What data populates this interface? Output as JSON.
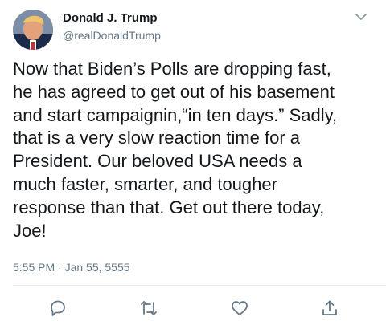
{
  "tweet": {
    "author": {
      "name": "Donald J. Trump",
      "handle": "@realDonaldTrump",
      "avatar_icon": "profile-photo"
    },
    "text_lines": [
      "Now that Biden’s Polls are dropping fast,",
      "he has agreed to get out of his basement",
      "and start campaignin,“in ten days.” Sadly,",
      "that is a very slow reaction time for a",
      "President. Our beloved USA needs a",
      "much faster, smarter, and tougher",
      "response than that. Get out there today,",
      "Joe!"
    ],
    "timestamp": "5:55 PM · Jan 55, 5555",
    "actions": {
      "reply_icon": "reply-icon",
      "retweet_icon": "retweet-icon",
      "like_icon": "heart-icon",
      "share_icon": "share-icon"
    },
    "menu_icon": "chevron-down-icon"
  },
  "colors": {
    "text": "#14171a",
    "secondary": "#657786",
    "divider": "#e6ecf0"
  }
}
